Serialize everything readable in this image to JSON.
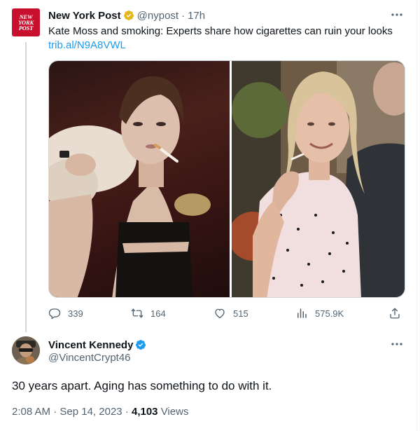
{
  "original_tweet": {
    "author_name": "New York Post",
    "handle": "@nypost",
    "separator": "·",
    "time": "17h",
    "avatar_lines": [
      "NEW",
      "YORK",
      "POST"
    ],
    "text": "Kate Moss and smoking: Experts share how cigarettes can ruin your looks",
    "link": "trib.al/N9A8VWL",
    "verified_badge_color": "#e2b719",
    "more_icon": "more-dots-icon",
    "actions": {
      "replies": "339",
      "reposts": "164",
      "likes": "515",
      "views": "575.9K"
    },
    "media": {
      "count": 2
    }
  },
  "reply_tweet": {
    "author_name": "Vincent Kennedy",
    "handle": "@VincentCrypt46",
    "verified_badge_color": "#1d9bf0",
    "text": "30 years apart. Aging has something to do with it.",
    "time": "2:08 AM",
    "separator": "·",
    "date": "Sep 14, 2023",
    "views_count": "4,103",
    "views_label": "Views"
  },
  "colors": {
    "text_primary": "#0f1419",
    "text_secondary": "#536471",
    "link": "#1d9bf0",
    "nypost_red": "#c8102e"
  }
}
